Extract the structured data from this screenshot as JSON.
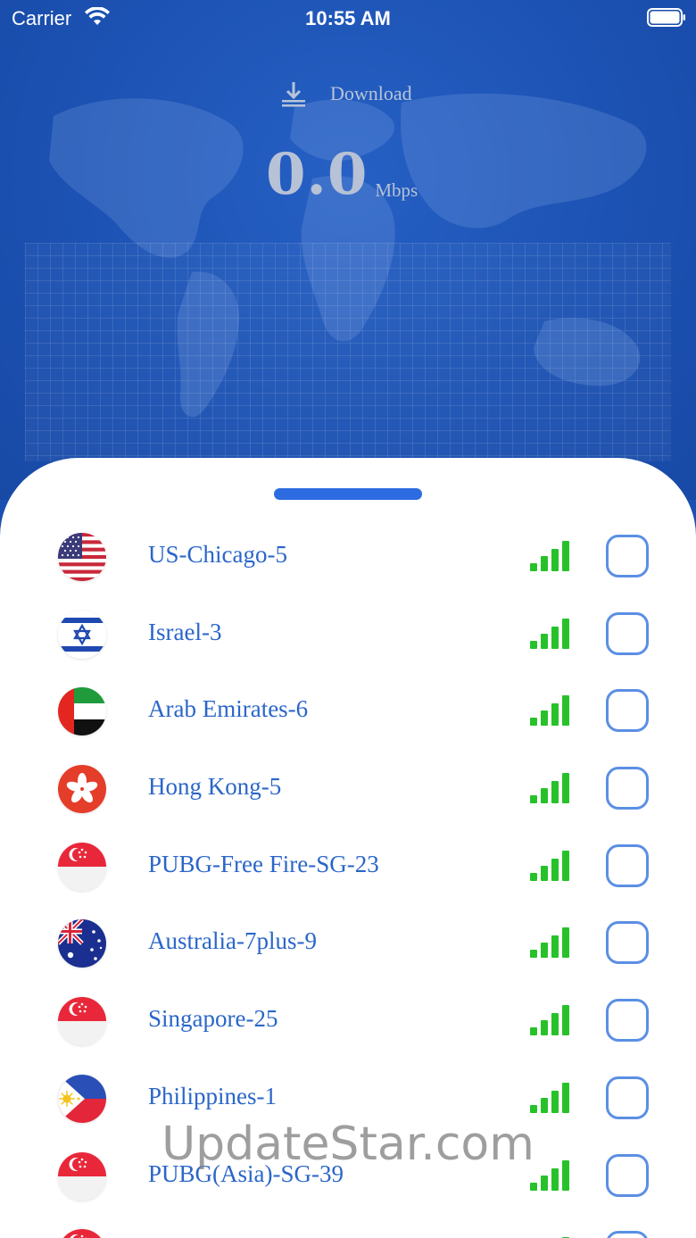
{
  "status_bar": {
    "carrier": "Carrier",
    "time": "10:55 AM",
    "icons": [
      "wifi-icon",
      "battery-icon"
    ]
  },
  "header": {
    "download_label": "Download",
    "download_icon": "download-icon",
    "speed_value": "0.0",
    "speed_unit": "Mbps"
  },
  "servers": [
    {
      "name": "US-Chicago-5",
      "flag": "us-flag-icon",
      "signal_bars": 4
    },
    {
      "name": "Israel-3",
      "flag": "israel-flag-icon",
      "signal_bars": 4
    },
    {
      "name": "Arab Emirates-6",
      "flag": "uae-flag-icon",
      "signal_bars": 4
    },
    {
      "name": "Hong Kong-5",
      "flag": "hong-kong-flag-icon",
      "signal_bars": 4
    },
    {
      "name": "PUBG-Free Fire-SG-23",
      "flag": "singapore-flag-icon",
      "signal_bars": 4
    },
    {
      "name": "Australia-7plus-9",
      "flag": "australia-flag-icon",
      "signal_bars": 4
    },
    {
      "name": "Singapore-25",
      "flag": "singapore-flag-icon",
      "signal_bars": 4
    },
    {
      "name": "Philippines-1",
      "flag": "philippines-flag-icon",
      "signal_bars": 4
    },
    {
      "name": "PUBG(Asia)-SG-39",
      "flag": "singapore-flag-icon",
      "signal_bars": 4
    },
    {
      "name": "",
      "flag": "singapore-flag-icon",
      "signal_bars": 4
    }
  ],
  "watermark": "UpdateStar.com",
  "colors": {
    "header_blue": "#1c52b3",
    "accent_blue": "#2c6be0",
    "server_text": "#2a66c9",
    "signal_green": "#27c22a",
    "checkbox_border": "#5b8fe4"
  }
}
